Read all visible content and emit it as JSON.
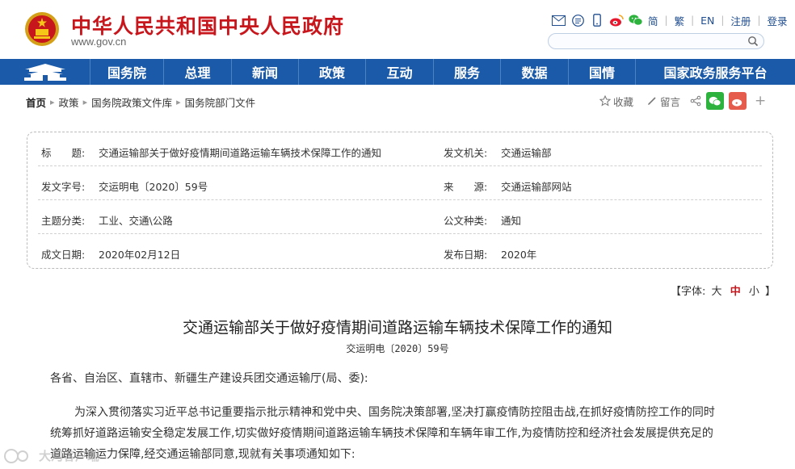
{
  "header": {
    "site_title": "中华人民共和国中央人民政府",
    "site_url": "www.gov.cn",
    "top_links": [
      "简",
      "繁",
      "EN",
      "注册",
      "登录"
    ],
    "search": {
      "placeholder": ""
    },
    "icons": [
      "email-icon",
      "message-icon",
      "mobile-icon",
      "weibo-icon",
      "wechat-icon"
    ]
  },
  "nav": {
    "items": [
      "国务院",
      "总理",
      "新闻",
      "政策",
      "互动",
      "服务",
      "数据",
      "国情",
      "国家政务服务平台"
    ]
  },
  "breadcrumb": {
    "items": [
      "首页",
      "政策",
      "国务院政策文件库",
      "国务院部门文件"
    ]
  },
  "tools": {
    "favorite_label": "收藏",
    "comment_label": "留言",
    "plus_label": "+"
  },
  "info": {
    "rows": [
      {
        "left_label": "标　　题:",
        "left_value": "交通运输部关于做好疫情期间道路运输车辆技术保障工作的通知",
        "right_label": "发文机关:",
        "right_value": "交通运输部"
      },
      {
        "left_label": "发文字号:",
        "left_value": "交运明电〔2020〕59号",
        "right_label": "来　　源:",
        "right_value": "交通运输部网站"
      },
      {
        "left_label": "主题分类:",
        "left_value": "工业、交通\\公路",
        "right_label": "公文种类:",
        "right_value": "通知"
      },
      {
        "left_label": "成文日期:",
        "left_value": "2020年02月12日",
        "right_label": "发布日期:",
        "right_value": "2020年"
      }
    ]
  },
  "article": {
    "font_size_label": "【字体:",
    "font_sizes": [
      "大",
      "中",
      "小"
    ],
    "font_size_close": "】",
    "title": "交通运输部关于做好疫情期间道路运输车辆技术保障工作的通知",
    "doc_number": "交运明电〔2020〕59号",
    "salutation": "各省、自治区、直辖市、新疆生产建设兵团交通运输厅(局、委):",
    "paragraph_lines": [
      "为深入贯彻落实习近平总书记重要指示批示精神和党中央、国务院决策部署,坚决打赢疫情防控阻击战,在抓好疫情防控工作的同时",
      "统筹抓好道路运输安全稳定发展工作,切实做好疫情期间道路运输车辆技术保障和车辆年审工作,为疫情防控和经济社会发展提供充足的",
      "道路运输运力保障,经交通运输部同意,现就有关事项通知如下:"
    ]
  },
  "watermark": {
    "text": "大河客户端"
  },
  "colors": {
    "brand_red": "#c8161d",
    "nav_blue": "#1a5aa8",
    "link_blue": "#1f4d8f"
  }
}
